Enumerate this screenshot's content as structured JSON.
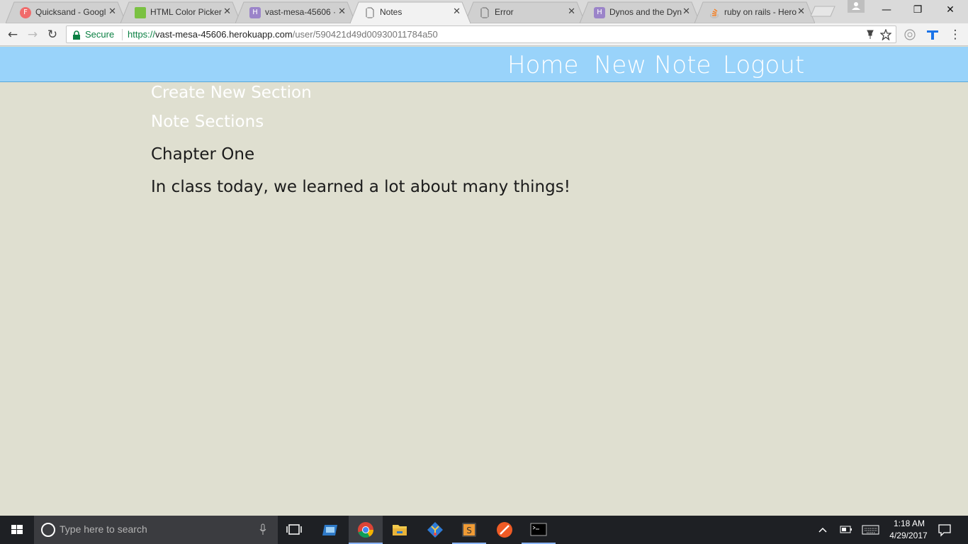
{
  "browser": {
    "tabs": [
      {
        "title": "Quicksand - Googl",
        "favicon": "google-fonts-icon",
        "favicon_glyph": "F",
        "favicon_color": "#f06b6b",
        "active": false
      },
      {
        "title": "HTML Color Picker",
        "favicon": "color-picker-icon",
        "favicon_glyph": "",
        "favicon_color": "#7ac142",
        "active": false
      },
      {
        "title": "vast-mesa-45606 ·",
        "favicon": "heroku-icon",
        "favicon_glyph": "H",
        "favicon_color": "#9b84c9",
        "active": false
      },
      {
        "title": "Notes",
        "favicon": "page-icon",
        "favicon_glyph": "",
        "favicon_color": "",
        "active": true
      },
      {
        "title": "Error",
        "favicon": "page-icon",
        "favicon_glyph": "",
        "favicon_color": "",
        "active": false
      },
      {
        "title": "Dynos and the Dyn",
        "favicon": "heroku-icon",
        "favicon_glyph": "H",
        "favicon_color": "#9b84c9",
        "active": false
      },
      {
        "title": "ruby on rails - Hero",
        "favicon": "stackoverflow-icon",
        "favicon_glyph": "",
        "favicon_color": "#f48024",
        "active": false
      }
    ],
    "close_glyph": "✕",
    "window_controls": {
      "minimize": "—",
      "maximize": "❐",
      "close": "✕"
    },
    "toolbar": {
      "back": "←",
      "forward": "→",
      "reload": "↻",
      "secure_label": "Secure",
      "url_scheme": "https://",
      "url_host": "vast-mesa-45606.herokuapp.com",
      "url_path": "/user/590421d49d00930011784a50",
      "menu_glyph": "⋮"
    }
  },
  "site": {
    "nav": {
      "home": "Home",
      "new_note": "New Note",
      "logout": "Logout"
    },
    "sidebar": {
      "create_section": "Create New Section",
      "note_sections": "Note Sections"
    },
    "note": {
      "title": "Chapter One",
      "body": "In class today, we learned a lot about many things!"
    },
    "colors": {
      "nav_bg": "#99d3fa",
      "page_bg": "#dfdfd0",
      "link_text": "#ffffff",
      "body_text": "#1b1b1b"
    }
  },
  "taskbar": {
    "search_placeholder": "Type here to search",
    "clock": {
      "time": "1:18 AM",
      "date": "4/29/2017"
    },
    "apps": [
      "task-view-icon",
      "remote-desktop-icon",
      "chrome-icon",
      "file-explorer-icon",
      "git-icon",
      "sublime-text-icon",
      "postman-icon",
      "terminal-icon"
    ]
  }
}
